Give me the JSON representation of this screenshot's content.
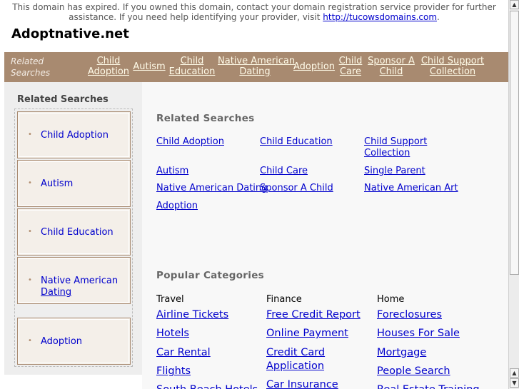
{
  "notice": {
    "text_line1": "This domain has expired. If you owned this domain, contact your domain registration service provider for further",
    "text_line2": "assistance. If you need help identifying your provider, visit ",
    "link": "http://tucowsdomains.com",
    "text_end": "."
  },
  "site": {
    "title": "Adoptnative.net"
  },
  "topbar": {
    "label_line1": "Related",
    "label_line2": "Searches",
    "links": [
      {
        "l1": "Child",
        "l2": "Adoption"
      },
      {
        "l1": "Autism",
        "l2": ""
      },
      {
        "l1": "Child",
        "l2": "Education"
      },
      {
        "l1": "Native American",
        "l2": "Dating"
      },
      {
        "l1": "Adoption",
        "l2": ""
      },
      {
        "l1": "Child",
        "l2": "Care"
      },
      {
        "l1": "Sponsor A",
        "l2": "Child"
      },
      {
        "l1": "Child Support",
        "l2": "Collection"
      }
    ]
  },
  "sidebar": {
    "heading": "Related Searches",
    "items": [
      {
        "l1": "Child Adoption",
        "l2": ""
      },
      {
        "l1": "Autism",
        "l2": ""
      },
      {
        "l1": "Child Education",
        "l2": ""
      },
      {
        "l1": "Native American",
        "l2": "Dating"
      },
      {
        "l1": "Adoption",
        "l2": ""
      }
    ],
    "bullet": "•"
  },
  "main": {
    "related_heading": "Related Searches",
    "related_links": [
      {
        "l1": "Child Adoption",
        "l2": ""
      },
      {
        "l1": "Child Education",
        "l2": ""
      },
      {
        "l1": "Child Support",
        "l2": "Collection"
      },
      {
        "l1": "Autism",
        "l2": ""
      },
      {
        "l1": "Child Care",
        "l2": ""
      },
      {
        "l1": "Single Parent",
        "l2": ""
      },
      {
        "l1": "Native American Dating",
        "l2": ""
      },
      {
        "l1": "Sponsor A Child",
        "l2": ""
      },
      {
        "l1": "Native American Art",
        "l2": ""
      },
      {
        "l1": "Adoption",
        "l2": ""
      }
    ],
    "popular_heading": "Popular Categories",
    "categories": [
      {
        "name": "Travel",
        "links": [
          "Airline Tickets",
          "Hotels",
          "Car Rental",
          "Flights",
          "South Beach Hotels"
        ]
      },
      {
        "name": "Finance",
        "links": [
          "Free Credit Report",
          "Online Payment",
          "Credit Card Application",
          "Car Insurance"
        ]
      },
      {
        "name": "Home",
        "links": [
          "Foreclosures",
          "Houses For Sale",
          "Mortgage",
          "People Search",
          "Real Estate Training"
        ]
      }
    ]
  },
  "scrollbar": {
    "up": "▲",
    "down": "▼"
  }
}
